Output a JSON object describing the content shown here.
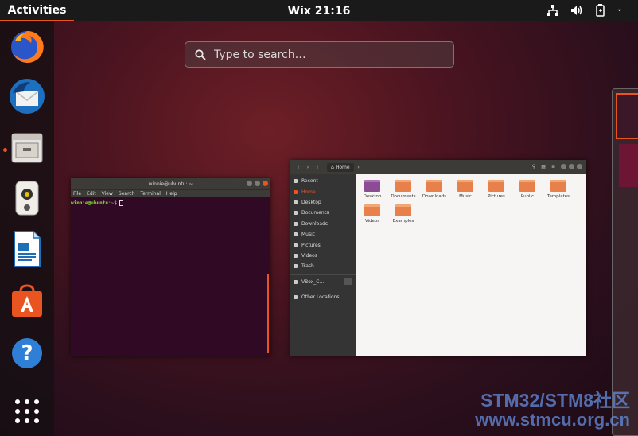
{
  "topbar": {
    "activities_label": "Activities",
    "clock": "Wix 21:16",
    "tray": [
      "network-icon",
      "volume-icon",
      "battery-icon",
      "system-menu-arrow-icon"
    ]
  },
  "dock": {
    "apps": [
      {
        "name": "Firefox",
        "icon": "firefox-icon"
      },
      {
        "name": "Thunderbird",
        "icon": "thunderbird-icon"
      },
      {
        "name": "Files",
        "icon": "files-icon",
        "running": true
      },
      {
        "name": "Rhythmbox",
        "icon": "rhythmbox-icon"
      },
      {
        "name": "LibreOffice Writer",
        "icon": "writer-icon"
      },
      {
        "name": "Ubuntu Software",
        "icon": "software-icon"
      },
      {
        "name": "Help",
        "icon": "help-icon"
      },
      {
        "name": "Show Applications",
        "icon": "app-grid-icon"
      }
    ],
    "help_glyph": "?"
  },
  "search": {
    "placeholder": "Type to search…"
  },
  "terminal": {
    "title": "winnie@ubuntu: ~",
    "menu": [
      "File",
      "Edit",
      "View",
      "Search",
      "Terminal",
      "Help"
    ],
    "prompt_user": "winnie@ubuntu",
    "prompt_sep": ":",
    "prompt_path": "~",
    "prompt_end": "$"
  },
  "files": {
    "location": "Home",
    "sidebar": {
      "recent": "Recent",
      "home": "Home",
      "desktop": "Desktop",
      "documents": "Documents",
      "downloads": "Downloads",
      "music": "Music",
      "pictures": "Pictures",
      "videos": "Videos",
      "trash": "Trash",
      "vbox": "VBox_C…",
      "other": "Other Locations"
    },
    "folders": {
      "desktop": "Desktop",
      "documents": "Documents",
      "downloads": "Downloads",
      "music": "Music",
      "pictures": "Pictures",
      "public": "Public",
      "templates": "Templates",
      "videos": "Videos",
      "examples": "Examples"
    }
  },
  "watermark": {
    "line1": "STM32/STM8社区",
    "line2": "www.stmcu.org.cn"
  },
  "colors": {
    "accent": "#e95420",
    "topbar": "#1a1a1a",
    "terminal_bg": "#300a24"
  }
}
